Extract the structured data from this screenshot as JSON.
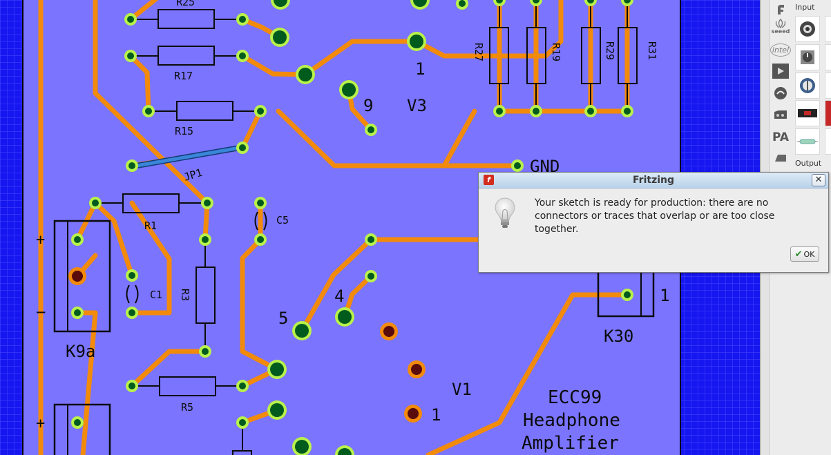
{
  "colors": {
    "grid_background": "#1616f0",
    "board": "#7a74ff",
    "trace": "#f28a0c",
    "pad_ring": "#b9f24a",
    "pad_hole": "#005b1d",
    "silkscreen": "#0b0b0b",
    "jumper": "#2a6fd4"
  },
  "pcb_labels": {
    "r25": "R25",
    "r17": "R17",
    "r15": "R15",
    "jp1": "JP1",
    "r1": "R1",
    "c5": "C5",
    "c1": "C1",
    "r3": "R3",
    "k9a": "K9a",
    "plus": "+",
    "minus": "−",
    "r5": "R5",
    "r27": "R27",
    "r19": "R19",
    "r29": "R29",
    "r31": "R31",
    "v3": "V3",
    "pin1_v3": "1",
    "pin9": "9",
    "gnd": "GND",
    "pin5": "5",
    "pin4": "4",
    "v1": "V1",
    "pin1_v1": "1",
    "k30": "K30",
    "pin1_k30": "1",
    "ecc_title_1": "ECC99",
    "ecc_title_2": "Headphone",
    "ecc_title_3": "Amplifier"
  },
  "parts_bin": {
    "section_input": "Input",
    "section_output": "Output",
    "categories": [
      "fritzing-icon",
      "seeed-icon",
      "intel-icon",
      "play-icon",
      "mic-icon",
      "pcb-icon",
      "pa-icon",
      "core-icon"
    ],
    "seeed_label": "seeed",
    "intel_label": "intel",
    "pa_label": "PA"
  },
  "dialog": {
    "title": "Fritzing",
    "app_icon": "f",
    "close_icon": "✕",
    "message": "Your sketch is ready for production: there are no connectors or traces that overlap or are too close together.",
    "ok_label": "OK"
  }
}
